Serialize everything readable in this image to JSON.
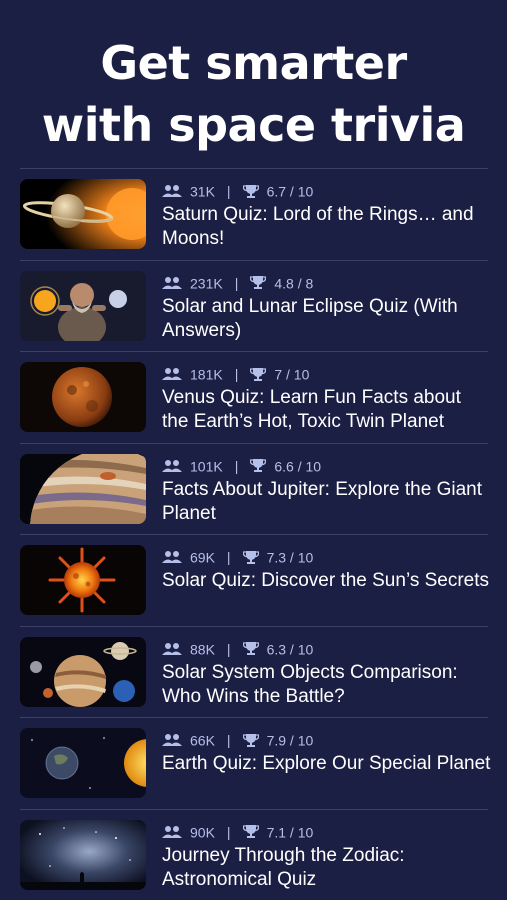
{
  "header": {
    "line1": "Get smarter",
    "line2": "with space trivia"
  },
  "icons": {
    "players": "people-icon",
    "score": "trophy-icon"
  },
  "colors": {
    "background": "#1c1f44",
    "meta_text": "#b4bfea",
    "divider": "#3d4168"
  },
  "quizzes": [
    {
      "players": "31K",
      "score": "6.7 / 10",
      "title": "Saturn Quiz: Lord of the Rings… and Moons!"
    },
    {
      "players": "231K",
      "score": "4.8 / 8",
      "title": "Solar and Lunar Eclipse Quiz (With Answers)"
    },
    {
      "players": "181K",
      "score": "7 / 10",
      "title": "Venus Quiz: Learn Fun Facts about the Earth’s Hot, Toxic Twin Planet"
    },
    {
      "players": "101K",
      "score": "6.6 / 10",
      "title": "Facts About Jupiter: Explore the Giant Planet"
    },
    {
      "players": "69K",
      "score": "7.3 / 10",
      "title": "Solar Quiz: Discover the Sun’s Secrets"
    },
    {
      "players": "88K",
      "score": "6.3 / 10",
      "title": "Solar System Objects Comparison: Who Wins the Battle?"
    },
    {
      "players": "66K",
      "score": "7.9 / 10",
      "title": "Earth Quiz: Explore Our Special Planet"
    },
    {
      "players": "90K",
      "score": "7.1 / 10",
      "title": "Journey Through the Zodiac: Astronomical Quiz"
    }
  ]
}
